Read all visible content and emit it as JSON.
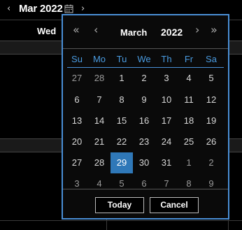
{
  "header": {
    "prev_arrow": "‹",
    "next_arrow": "›",
    "title": "Mar 2022",
    "calendar_icon": "calendar-icon"
  },
  "background": {
    "day_header": "Wed"
  },
  "picker": {
    "prev_year": "«",
    "prev_month": "‹",
    "month": "March",
    "year": "2022",
    "next_month": "›",
    "next_year": "»",
    "weekdays": [
      "Su",
      "Mo",
      "Tu",
      "We",
      "Th",
      "Fr",
      "Sa"
    ],
    "weeks": [
      [
        "27",
        "28",
        "1",
        "2",
        "3",
        "4",
        "5"
      ],
      [
        "6",
        "7",
        "8",
        "9",
        "10",
        "11",
        "12"
      ],
      [
        "13",
        "14",
        "15",
        "16",
        "17",
        "18",
        "19"
      ],
      [
        "20",
        "21",
        "22",
        "23",
        "24",
        "25",
        "26"
      ],
      [
        "27",
        "28",
        "29",
        "30",
        "31",
        "1",
        "2"
      ],
      [
        "3",
        "4",
        "5",
        "6",
        "7",
        "8",
        "9"
      ]
    ],
    "selected_day": "29",
    "today_label": "Today",
    "cancel_label": "Cancel"
  },
  "colors": {
    "accent": "#4a8fd6",
    "selected_bg": "#2f78b8",
    "weekday_text": "#4a9be0"
  }
}
